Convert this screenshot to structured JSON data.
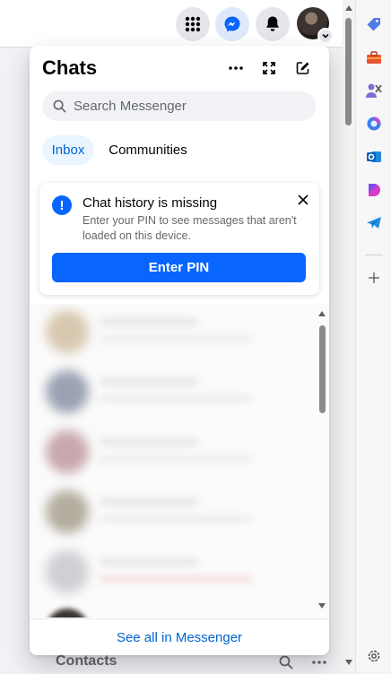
{
  "panel": {
    "title": "Chats",
    "search_placeholder": "Search Messenger",
    "tabs": [
      {
        "label": "Inbox",
        "active": true
      },
      {
        "label": "Communities",
        "active": false
      }
    ],
    "alert": {
      "title": "Chat history is missing",
      "body": "Enter your PIN to see messages that aren't loaded on this device.",
      "button_label": "Enter PIN"
    },
    "footer_link": "See all in Messenger"
  },
  "bottom": {
    "contacts_label": "Contacts"
  },
  "colors": {
    "accent": "#0866ff",
    "link": "#0064d1",
    "tab_active_bg": "#ebf5ff"
  },
  "icons": {
    "topbar": [
      "apps-grid-icon",
      "messenger-icon",
      "bell-icon",
      "profile-avatar"
    ],
    "edge_sidebar": [
      "tag-icon",
      "toolbox-icon",
      "people-icon",
      "copilot-icon",
      "outlook-icon",
      "drop-icon",
      "telegram-icon",
      "plus-icon",
      "gear-icon"
    ]
  }
}
